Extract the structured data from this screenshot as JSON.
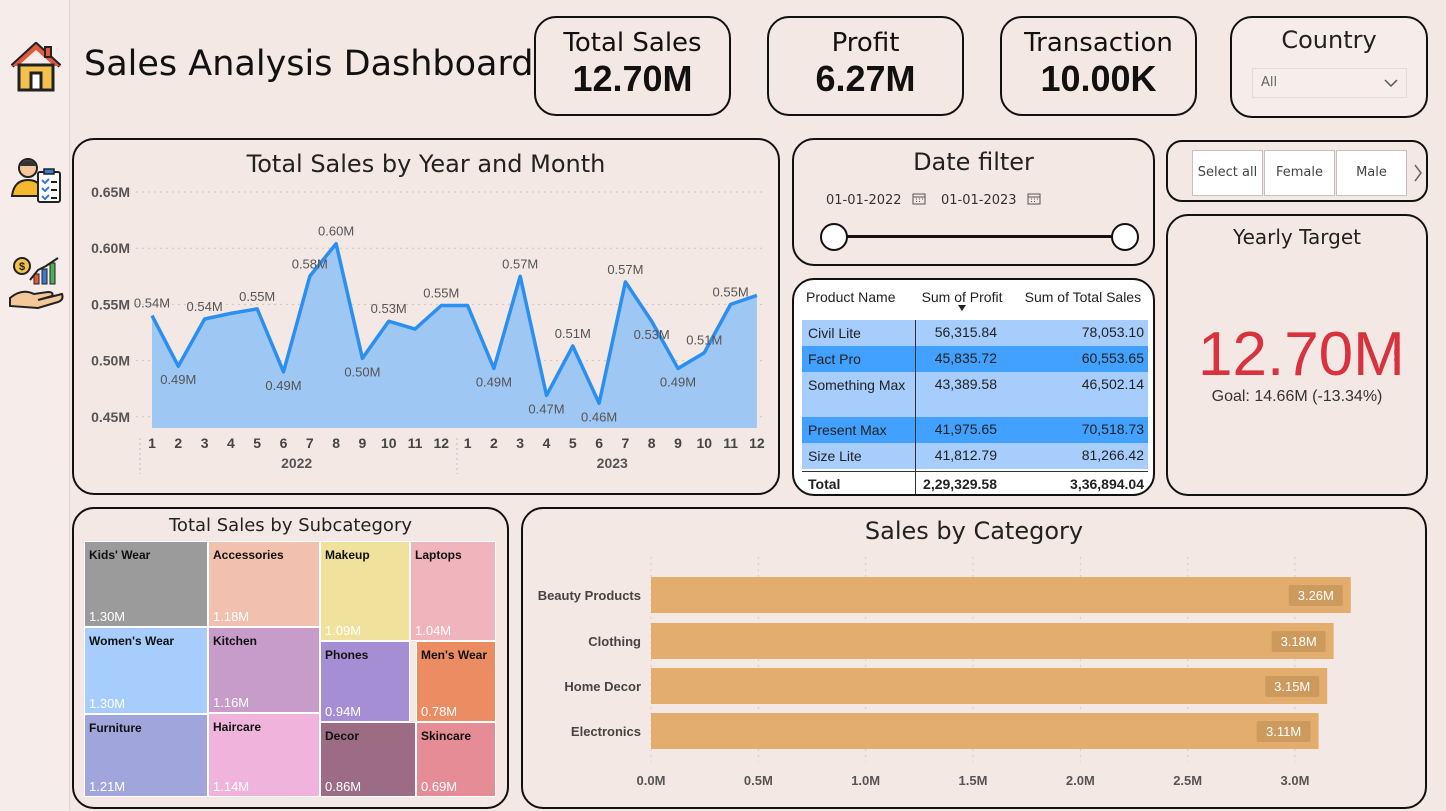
{
  "app": {
    "title": "Sales Analysis Dashboard"
  },
  "sidebar": {
    "icons": [
      "home-icon",
      "user-report-icon",
      "sales-growth-icon"
    ]
  },
  "kpis": [
    {
      "label": "Total Sales",
      "value": "12.70M"
    },
    {
      "label": "Profit",
      "value": "6.27M"
    },
    {
      "label": "Transaction",
      "value": "10.00K"
    }
  ],
  "country": {
    "label": "Country",
    "selected": "All"
  },
  "gender": {
    "options": [
      "Select all",
      "Female",
      "Male"
    ]
  },
  "date_filter": {
    "title": "Date filter",
    "start": "01-01-2022",
    "end": "01-01-2023"
  },
  "yearly_target": {
    "title": "Yearly Target",
    "value": "12.70M",
    "alert": "!",
    "goal": "Goal: 14.66M (-13.34%)"
  },
  "product_table": {
    "headers": [
      "Product Name",
      "Sum of Profit",
      "Sum of Total Sales"
    ],
    "rows": [
      {
        "name": "Civil Lite",
        "profit": "56,315.84",
        "sales": "78,053.10"
      },
      {
        "name": "Fact Pro",
        "profit": "45,835.72",
        "sales": "60,553.65"
      },
      {
        "name": "Something Max",
        "profit": "43,389.58",
        "sales": "46,502.14"
      },
      {
        "name": "Present Max",
        "profit": "41,975.65",
        "sales": "70,518.73"
      },
      {
        "name": "Size Lite",
        "profit": "41,812.79",
        "sales": "81,266.42"
      }
    ],
    "total": {
      "name": "Total",
      "profit": "2,29,329.58",
      "sales": "3,36,894.04"
    }
  },
  "chart_data": [
    {
      "type": "area",
      "title": "Total Sales by Year and Month",
      "x": [
        "1",
        "2",
        "3",
        "4",
        "5",
        "6",
        "7",
        "8",
        "9",
        "10",
        "11",
        "12",
        "1",
        "2",
        "3",
        "4",
        "5",
        "6",
        "7",
        "8",
        "9",
        "10",
        "11",
        "12"
      ],
      "x_groups": [
        "2022",
        "2023"
      ],
      "values": [
        0.54,
        0.495,
        0.537,
        0.542,
        0.546,
        0.49,
        0.575,
        0.604,
        0.502,
        0.535,
        0.528,
        0.549,
        0.549,
        0.493,
        0.575,
        0.469,
        0.513,
        0.462,
        0.57,
        0.535,
        0.493,
        0.507,
        0.55,
        0.558
      ],
      "data_labels": [
        "0.54M",
        "0.49M",
        "0.54M",
        "",
        "0.55M",
        "0.49M",
        "0.58M",
        "0.60M",
        "0.50M",
        "0.53M",
        "",
        "0.55M",
        "",
        "0.49M",
        "0.57M",
        "0.47M",
        "0.51M",
        "0.46M",
        "0.57M",
        "0.53M",
        "0.49M",
        "0.51M",
        "0.55M",
        ""
      ],
      "y_ticks": [
        "0.65M",
        "0.60M",
        "0.55M",
        "0.50M",
        "0.45M"
      ],
      "ylim": [
        0.44,
        0.65
      ],
      "color": "#2b8ff0"
    },
    {
      "type": "treemap",
      "title": "Total Sales by Subcategory",
      "items": [
        {
          "name": "Kids' Wear",
          "value": "1.30M",
          "color": "#9b9b9b"
        },
        {
          "name": "Women's Wear",
          "value": "1.30M",
          "color": "#a6cdfc"
        },
        {
          "name": "Furniture",
          "value": "1.21M",
          "color": "#a0a5dc"
        },
        {
          "name": "Accessories",
          "value": "1.18M",
          "color": "#f2c0ae"
        },
        {
          "name": "Kitchen",
          "value": "1.16M",
          "color": "#c79bca"
        },
        {
          "name": "Haircare",
          "value": "1.14M",
          "color": "#f0b4dc"
        },
        {
          "name": "Makeup",
          "value": "1.09M",
          "color": "#f0e29c"
        },
        {
          "name": "Phones",
          "value": "0.94M",
          "color": "#a58ed3"
        },
        {
          "name": "Decor",
          "value": "0.86M",
          "color": "#9c6c84"
        },
        {
          "name": "Laptops",
          "value": "1.04M",
          "color": "#f0b4bc"
        },
        {
          "name": "Men's Wear",
          "value": "0.78M",
          "color": "#ec8c62"
        },
        {
          "name": "Skincare",
          "value": "0.69M",
          "color": "#e68c96"
        }
      ]
    },
    {
      "type": "bar",
      "orientation": "horizontal",
      "title": "Sales by Category",
      "categories": [
        "Beauty Products",
        "Clothing",
        "Home Decor",
        "Electronics"
      ],
      "values": [
        3.26,
        3.18,
        3.15,
        3.11
      ],
      "data_labels": [
        "3.26M",
        "3.18M",
        "3.15M",
        "3.11M"
      ],
      "x_ticks": [
        "0.0M",
        "0.5M",
        "1.0M",
        "1.5M",
        "2.0M",
        "2.5M",
        "3.0M"
      ],
      "xlim": [
        0,
        3.0
      ],
      "color": "#e3ad6d"
    }
  ]
}
